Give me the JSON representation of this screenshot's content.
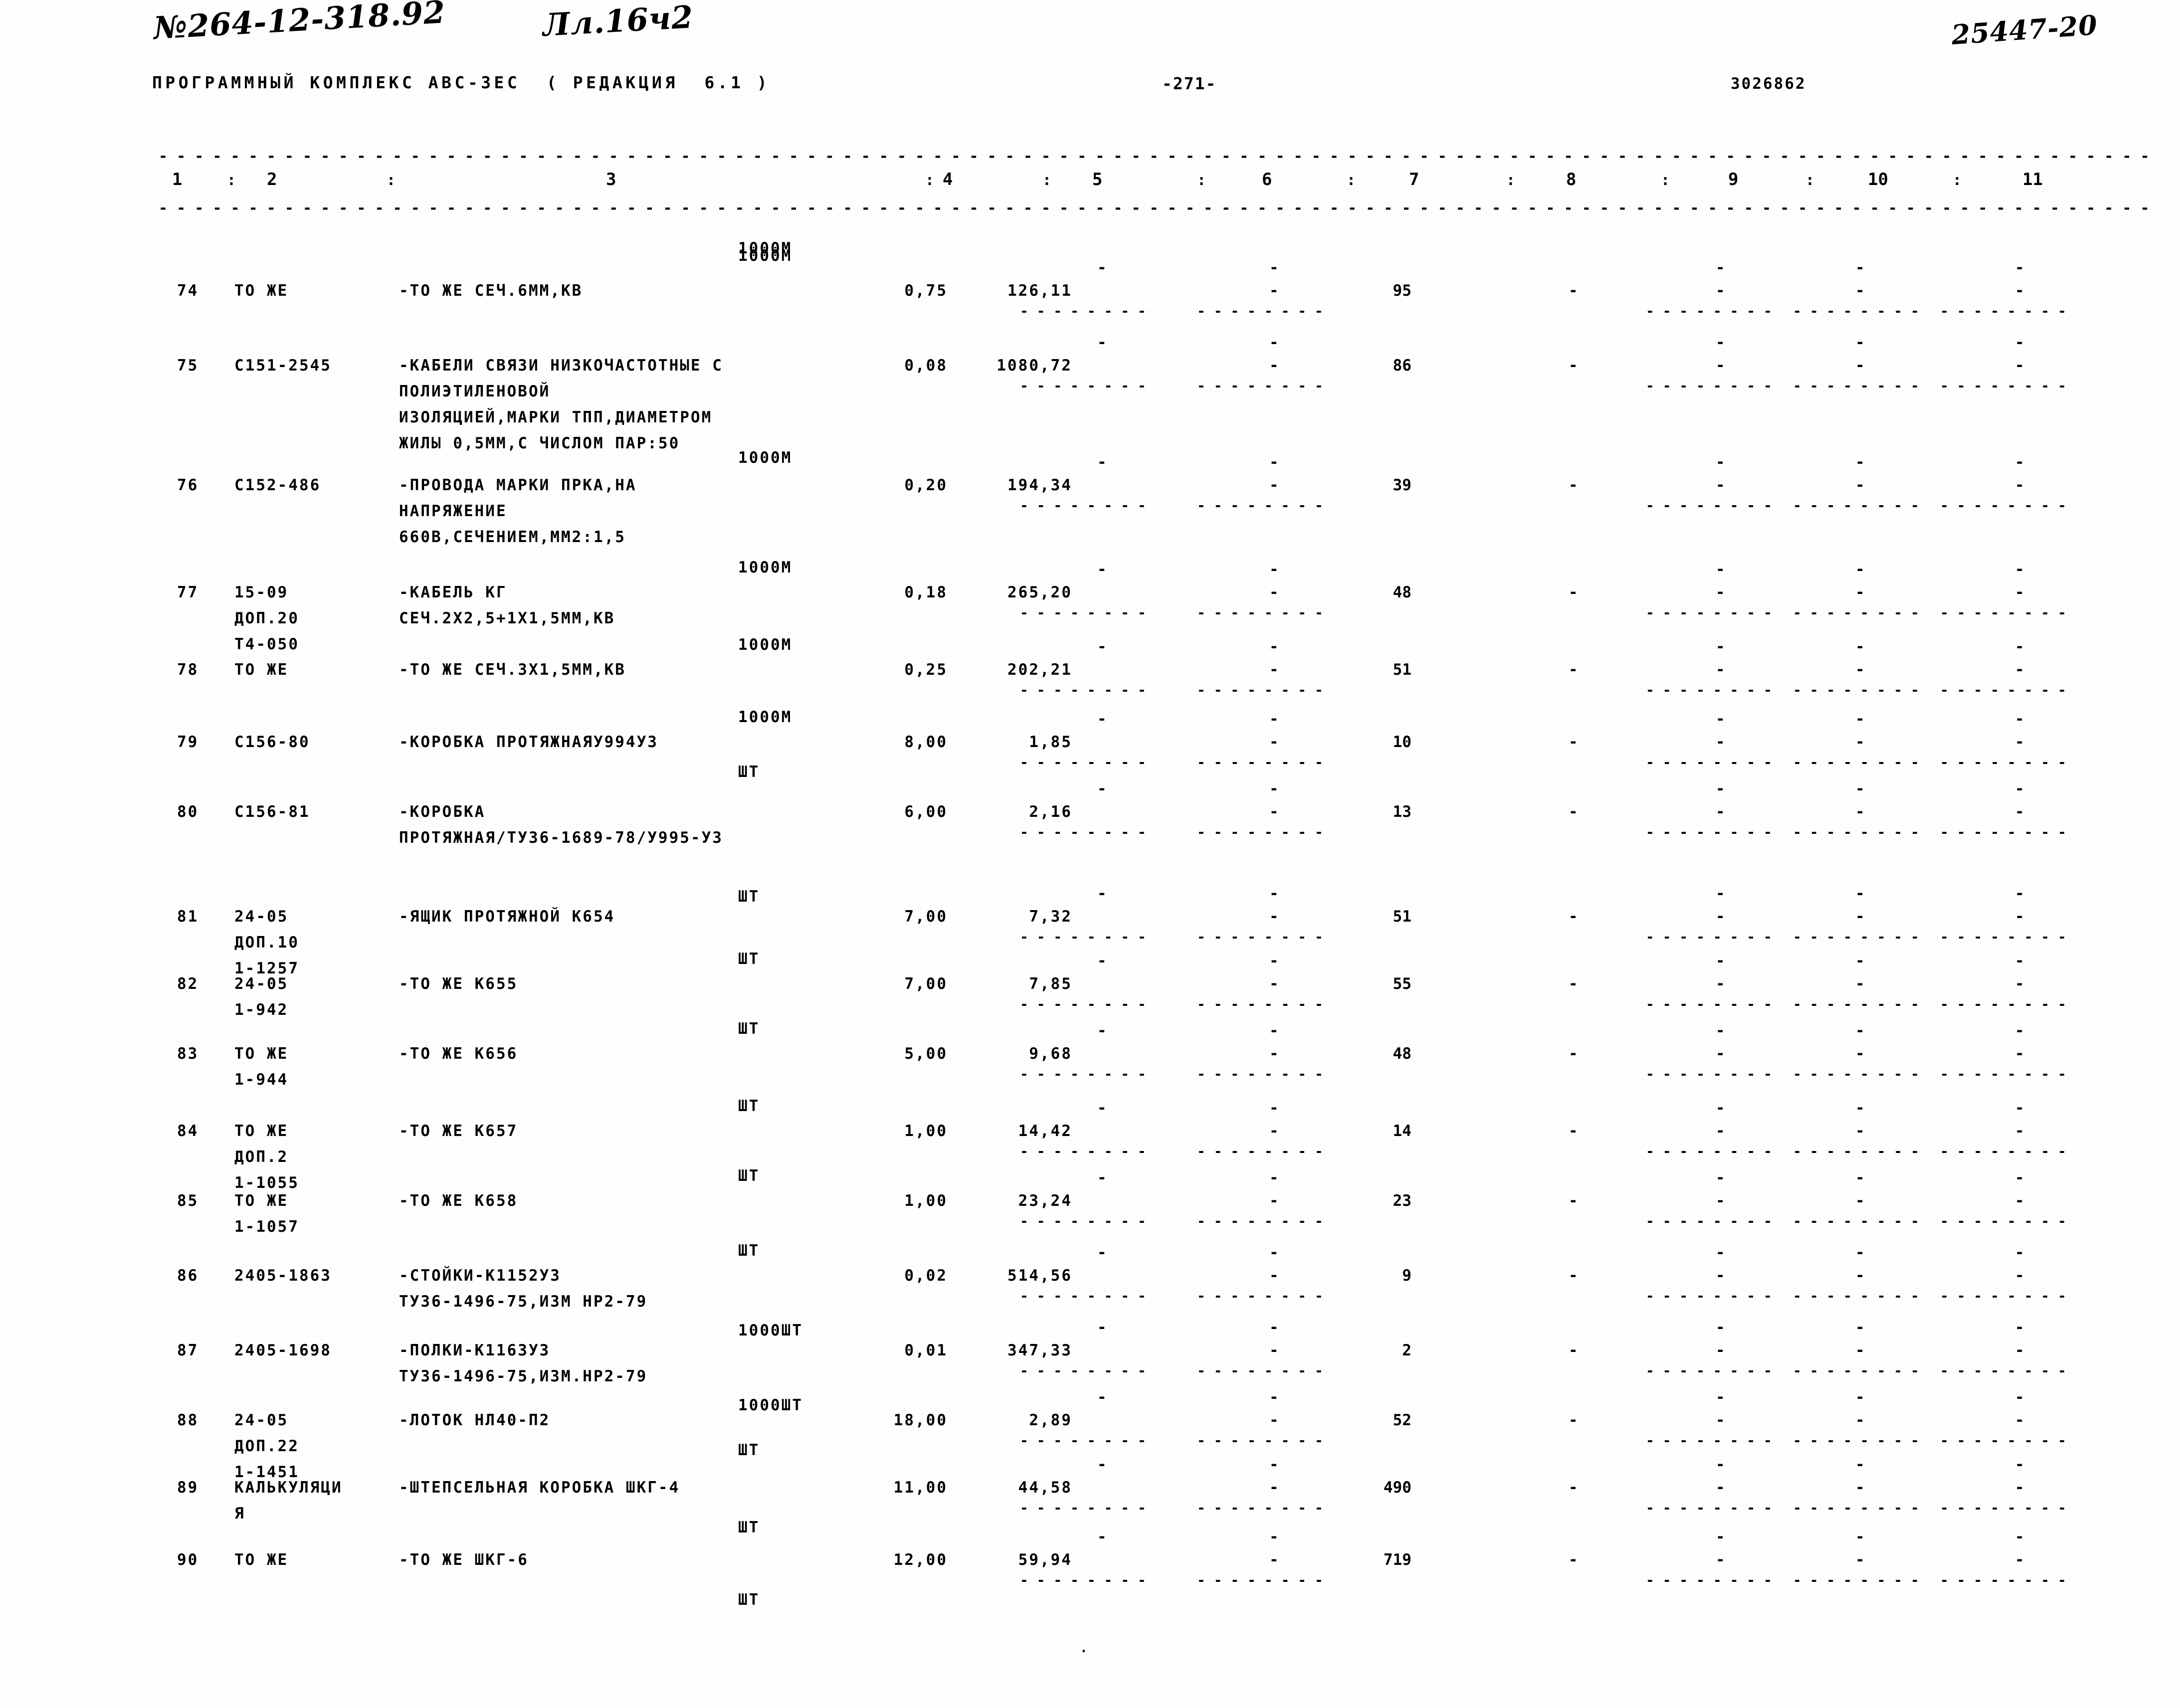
{
  "header": {
    "handwritten_code": "№264-12-318.92",
    "handwritten_sheet": "Лл.16ч2",
    "program_title": "ПРОГРАММНЫЙ КОМПЛЕКС АВС-3ЕС  ( РЕДАКЦИЯ  6.1 )",
    "page_number": "-271-",
    "doc_number": "3026862",
    "handwritten_right": "25447-20"
  },
  "columns": {
    "labels": [
      "1",
      "2",
      "3",
      "4",
      "5",
      "6",
      "7",
      "8",
      "9",
      "10",
      "11"
    ],
    "separator": ":"
  },
  "rules": {
    "dash_char": "-",
    "segment_char": "-"
  },
  "rows": [
    {
      "no": "74",
      "code_lines": [
        "ТО ЖЕ"
      ],
      "desc_lines": [
        "-ТО ЖЕ СЕЧ.6ММ,КВ"
      ],
      "unit": "1000М",
      "unit_above": "1000М",
      "c4": "0,75",
      "c5": "126,11",
      "c6": "-",
      "c7": "95",
      "c8": "-",
      "c9": "-",
      "c10": "-",
      "c11": "-"
    },
    {
      "no": "75",
      "code_lines": [
        "С151-2545"
      ],
      "desc_lines": [
        "-КАБЕЛИ СВЯЗИ НИЗКОЧАСТОТНЫЕ С",
        "ПОЛИЭТИЛЕНОВОЙ",
        "ИЗОЛЯЦИЕЙ,МАРКИ ТПП,ДИАМЕТРОМ",
        "ЖИЛЫ 0,5ММ,С ЧИСЛОМ ПАР:50"
      ],
      "unit": "1000М",
      "c4": "0,08",
      "c5": "1080,72",
      "c6": "-",
      "c7": "86",
      "c8": "-",
      "c9": "-",
      "c10": "-",
      "c11": "-"
    },
    {
      "no": "76",
      "code_lines": [
        "С152-486"
      ],
      "desc_lines": [
        "-ПРОВОДА МАРКИ ПРКА,НА",
        "НАПРЯЖЕНИЕ",
        "660В,СЕЧЕНИЕМ,ММ2:1,5"
      ],
      "unit": "1000М",
      "c4": "0,20",
      "c5": "194,34",
      "c6": "-",
      "c7": "39",
      "c8": "-",
      "c9": "-",
      "c10": "-",
      "c11": "-"
    },
    {
      "no": "77",
      "code_lines": [
        "15-09",
        "ДОП.20",
        "Т4-050"
      ],
      "desc_lines": [
        "-КАБЕЛЬ КГ",
        "СЕЧ.2Х2,5+1Х1,5ММ,КВ"
      ],
      "unit": "1000М",
      "c4": "0,18",
      "c5": "265,20",
      "c6": "-",
      "c7": "48",
      "c8": "-",
      "c9": "-",
      "c10": "-",
      "c11": "-"
    },
    {
      "no": "78",
      "code_lines": [
        "ТО ЖЕ"
      ],
      "desc_lines": [
        "-ТО ЖЕ СЕЧ.3Х1,5ММ,КВ"
      ],
      "unit": "1000М",
      "c4": "0,25",
      "c5": "202,21",
      "c6": "-",
      "c7": "51",
      "c8": "-",
      "c9": "-",
      "c10": "-",
      "c11": "-"
    },
    {
      "no": "79",
      "code_lines": [
        "С156-80"
      ],
      "desc_lines": [
        "-КОРОБКА ПРОТЯЖНАЯУ994У3"
      ],
      "unit": "ШТ",
      "c4": "8,00",
      "c5": "1,85",
      "c6": "-",
      "c7": "10",
      "c8": "-",
      "c9": "-",
      "c10": "-",
      "c11": "-"
    },
    {
      "no": "80",
      "code_lines": [
        "С156-81"
      ],
      "desc_lines": [
        "-КОРОБКА",
        "ПРОТЯЖНАЯ/ТУ36-1689-78/У995-У3"
      ],
      "unit": "ШТ",
      "c4": "6,00",
      "c5": "2,16",
      "c6": "-",
      "c7": "13",
      "c8": "-",
      "c9": "-",
      "c10": "-",
      "c11": "-"
    },
    {
      "no": "81",
      "code_lines": [
        "24-05",
        "ДОП.10",
        "1-1257"
      ],
      "desc_lines": [
        "-ЯЩИК ПРОТЯЖНОЙ К654"
      ],
      "unit": "ШТ",
      "c4": "7,00",
      "c5": "7,32",
      "c6": "-",
      "c7": "51",
      "c8": "-",
      "c9": "-",
      "c10": "-",
      "c11": "-"
    },
    {
      "no": "82",
      "code_lines": [
        "24-05",
        "1-942"
      ],
      "desc_lines": [
        "-ТО ЖЕ К655"
      ],
      "unit": "ШТ",
      "c4": "7,00",
      "c5": "7,85",
      "c6": "-",
      "c7": "55",
      "c8": "-",
      "c9": "-",
      "c10": "-",
      "c11": "-"
    },
    {
      "no": "83",
      "code_lines": [
        "ТО ЖЕ",
        "1-944"
      ],
      "desc_lines": [
        "-ТО ЖЕ К656"
      ],
      "unit": "ШТ",
      "c4": "5,00",
      "c5": "9,68",
      "c6": "-",
      "c7": "48",
      "c8": "-",
      "c9": "-",
      "c10": "-",
      "c11": "-"
    },
    {
      "no": "84",
      "code_lines": [
        "ТО ЖЕ",
        "ДОП.2",
        "1-1055"
      ],
      "desc_lines": [
        "-ТО ЖЕ К657"
      ],
      "unit": "ШТ",
      "c4": "1,00",
      "c5": "14,42",
      "c6": "-",
      "c7": "14",
      "c8": "-",
      "c9": "-",
      "c10": "-",
      "c11": "-"
    },
    {
      "no": "85",
      "code_lines": [
        "ТО ЖЕ",
        "1-1057"
      ],
      "desc_lines": [
        "-ТО ЖЕ К658"
      ],
      "unit": "ШТ",
      "c4": "1,00",
      "c5": "23,24",
      "c6": "-",
      "c7": "23",
      "c8": "-",
      "c9": "-",
      "c10": "-",
      "c11": "-"
    },
    {
      "no": "86",
      "code_lines": [
        "2405-1863"
      ],
      "desc_lines": [
        "-СТОЙКИ-К1152У3",
        "ТУ36-1496-75,ИЗМ НР2-79"
      ],
      "unit": "1000ШТ",
      "c4": "0,02",
      "c5": "514,56",
      "c6": "-",
      "c7": "9",
      "c8": "-",
      "c9": "-",
      "c10": "-",
      "c11": "-"
    },
    {
      "no": "87",
      "code_lines": [
        "2405-1698"
      ],
      "desc_lines": [
        "-ПОЛКИ-К1163У3",
        "ТУ36-1496-75,ИЗМ.НР2-79"
      ],
      "unit": "1000ШТ",
      "c4": "0,01",
      "c5": "347,33",
      "c6": "-",
      "c7": "2",
      "c8": "-",
      "c9": "-",
      "c10": "-",
      "c11": "-"
    },
    {
      "no": "88",
      "code_lines": [
        "24-05",
        "ДОП.22",
        "1-1451"
      ],
      "desc_lines": [
        "-ЛОТОК НЛ40-П2"
      ],
      "unit": "ШТ",
      "c4": "18,00",
      "c5": "2,89",
      "c6": "-",
      "c7": "52",
      "c8": "-",
      "c9": "-",
      "c10": "-",
      "c11": "-"
    },
    {
      "no": "89",
      "code_lines": [
        "КАЛЬКУЛЯЦИ",
        "Я"
      ],
      "desc_lines": [
        "-ШТЕПСЕЛЬНАЯ КОРОБКА ШКГ-4"
      ],
      "unit": "ШТ",
      "c4": "11,00",
      "c5": "44,58",
      "c6": "-",
      "c7": "490",
      "c8": "-",
      "c9": "-",
      "c10": "-",
      "c11": "-"
    },
    {
      "no": "90",
      "code_lines": [
        "ТО ЖЕ"
      ],
      "desc_lines": [
        "-ТО ЖЕ ШКГ-6"
      ],
      "unit": "ШТ",
      "c4": "12,00",
      "c5": "59,94",
      "c6": "-",
      "c7": "719",
      "c8": "-",
      "c9": "-",
      "c10": "-",
      "c11": "-"
    }
  ],
  "footer": {
    "mark": "."
  }
}
